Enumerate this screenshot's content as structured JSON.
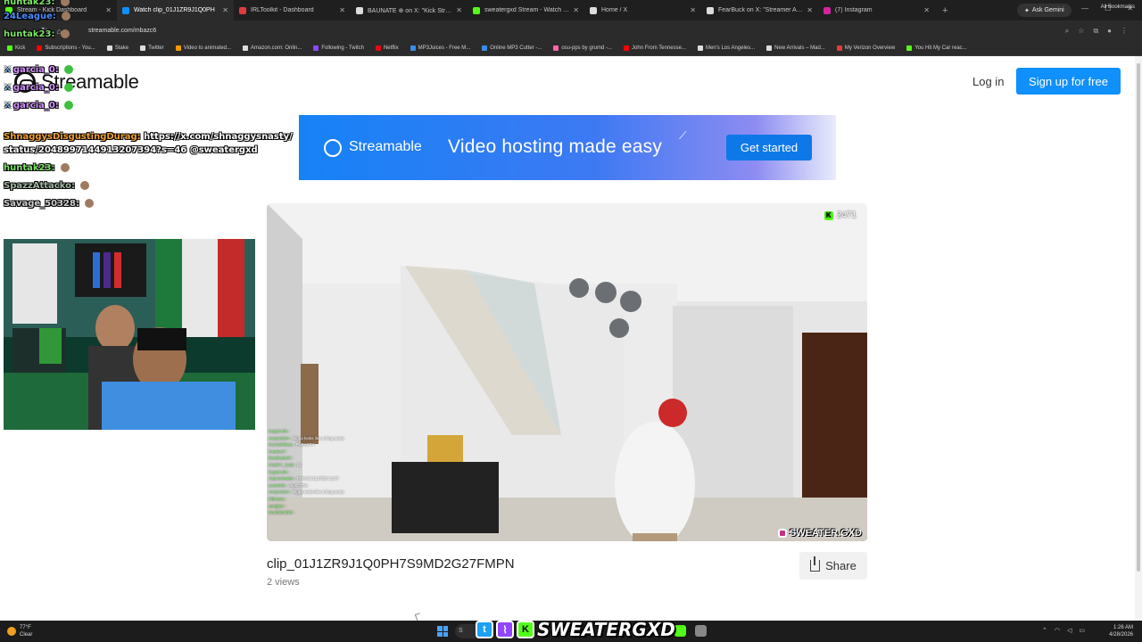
{
  "browser": {
    "tabs": [
      {
        "title": "Stream - Kick Dashboard",
        "color": "#53fc18",
        "active": false
      },
      {
        "title": "Watch clip_01J1ZR9J1Q0PH",
        "color": "#0f90fa",
        "active": true
      },
      {
        "title": "IRLToolkit - Dashboard",
        "color": "#e33b3b",
        "active": false
      },
      {
        "title": "BAUNATE ⊕ on X: \"Kick Stream",
        "color": "#dddddd",
        "active": false
      },
      {
        "title": "sweatergxd Stream - Watch Liv",
        "color": "#53fc18",
        "active": false
      },
      {
        "title": "Home / X",
        "color": "#dddddd",
        "active": false
      },
      {
        "title": "FearBuck on X: \"Streamer Actio",
        "color": "#dddddd",
        "active": false
      },
      {
        "title": "(7) Instagram",
        "color": "#d6249f",
        "active": false
      }
    ],
    "new_tab": "+",
    "ask_gemini": "Ask Gemini",
    "url": "streamable.com/mbazc6",
    "bookmarks": [
      {
        "label": "Kick",
        "color": "#53fc18"
      },
      {
        "label": "Subscriptions - You...",
        "color": "#ff0000"
      },
      {
        "label": "Stake",
        "color": "#dddddd"
      },
      {
        "label": "Twitter",
        "color": "#dddddd"
      },
      {
        "label": "Video to animated...",
        "color": "#ff9900"
      },
      {
        "label": "Amazon.com: Onlin...",
        "color": "#dddddd"
      },
      {
        "label": "Following - Twitch",
        "color": "#9146ff"
      },
      {
        "label": "Netflix",
        "color": "#e50914"
      },
      {
        "label": "MP3Juices - Free M...",
        "color": "#3b8beb"
      },
      {
        "label": "Online MP3 Cutter -...",
        "color": "#3b8beb"
      },
      {
        "label": "osu-pps by grumd -...",
        "color": "#ff66aa"
      },
      {
        "label": "John From Tennesse...",
        "color": "#ff0000"
      },
      {
        "label": "Men's Los Angeles...",
        "color": "#dddddd"
      },
      {
        "label": "New Arrivals – Mad...",
        "color": "#dddddd"
      },
      {
        "label": "My Verizon Overview",
        "color": "#e33b3b"
      },
      {
        "label": "You Hit My Car reac...",
        "color": "#53fc18"
      }
    ],
    "all_bookmarks": "All Bookmarks"
  },
  "site": {
    "logo_text": "Streamable",
    "login": "Log in",
    "signup": "Sign up for free"
  },
  "banner": {
    "brand": "Streamable",
    "tagline": "Video hosting made easy",
    "cta": "Get started"
  },
  "video": {
    "view_count": "2471",
    "watermark": "SWEATER.GXD",
    "chat_lines": [
      {
        "user": "SuppCuhh :",
        "msg": ""
      },
      {
        "user": "crazymdum :",
        "msg": "Nigga looks like a thug aunty"
      },
      {
        "user": "SomeDrBeau :",
        "msg": "FUPARTY"
      },
      {
        "user": "Fandom7 :",
        "msg": ""
      },
      {
        "user": "BeadnasteIII :",
        "msg": ""
      },
      {
        "user": "POOPY_GXD :",
        "msg": "lol"
      },
      {
        "user": "SuppCuhh :",
        "msg": ""
      },
      {
        "user": "JSportsNation :",
        "msg": "FATASS BLOOD CLOT"
      },
      {
        "user": "runtz0XD :",
        "msg": "crips OTW"
      },
      {
        "user": "crazymdum :",
        "msg": "Nigga looks like a thug aunty"
      },
      {
        "user": "Hbkssea :",
        "msg": ""
      },
      {
        "user": "sanglato :",
        "msg": ""
      },
      {
        "user": "Doodlebob69 :",
        "msg": ""
      }
    ]
  },
  "clip": {
    "title": "clip_01J1ZR9J1Q0PH7S9MD2G27FMPN",
    "views": "2 views",
    "share": "Share"
  },
  "overlay_chat": [
    {
      "user": "huntak23:",
      "msg": "",
      "color": "#7ee36a"
    },
    {
      "user": "24League:",
      "msg": "",
      "color": "#4a8cff"
    },
    {
      "user": "huntak23:",
      "msg": "",
      "color": "#7ee36a"
    },
    {
      "user": "garcia_0:",
      "msg": "",
      "color": "#d493ff"
    },
    {
      "user": "garcia_0:",
      "msg": "",
      "color": "#d493ff"
    },
    {
      "user": "garcia_0:",
      "msg": "",
      "color": "#d493ff"
    },
    {
      "user": "ShnaggysDisgustingDurag:",
      "msg": "https://x.com/shnaggysnasty/",
      "color": "#f0a030"
    },
    {
      "user": "",
      "msg": "status/2048997144913207394?s=46 @sweatergxd",
      "color": "#ffffff"
    },
    {
      "user": "huntak23:",
      "msg": "",
      "color": "#7ee36a"
    },
    {
      "user": "SpazzAttacko:",
      "msg": "",
      "color": "#9fb5a0"
    },
    {
      "user": "Savage_50328:",
      "msg": "",
      "color": "#cfcfcf"
    }
  ],
  "stream_branding": {
    "handle": "SWEATERGXD"
  },
  "taskbar": {
    "temp": "77°F",
    "condition": "Clear",
    "time": "1:26 AM",
    "date": "4/28/2026",
    "search": "S"
  }
}
